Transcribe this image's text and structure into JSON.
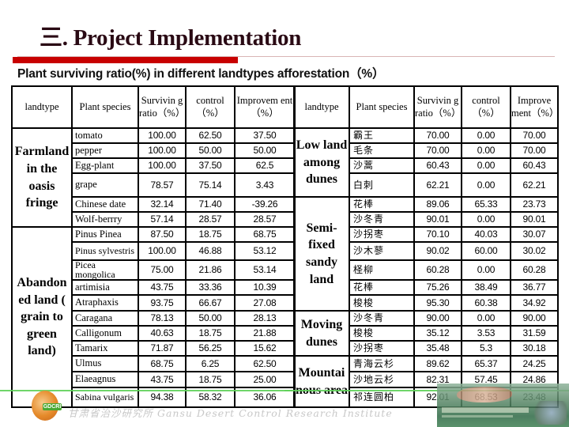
{
  "title": "三. Project Implementation",
  "subtitle": "Plant surviving ratio(%) in different landtypes afforestation（%）",
  "left_table": {
    "headers": [
      "landtype",
      "Plant species",
      "Survivin g ratio（%）",
      "control（%）",
      "Improvem ent（%）"
    ],
    "groups": [
      {
        "landtype": "Farmland in the oasis fringe",
        "rows": [
          {
            "species": "tomato",
            "surviving": "100.00",
            "control": "62.50",
            "improvement": "37.50"
          },
          {
            "species": "pepper",
            "surviving": "100.00",
            "control": "50.00",
            "improvement": "50.00"
          },
          {
            "species": "Egg-plant",
            "surviving": "100.00",
            "control": "37.50",
            "improvement": "62.5"
          },
          {
            "species": "grape",
            "surviving": "78.57",
            "control": "75.14",
            "improvement": "3.43"
          },
          {
            "species": "Chinese date",
            "surviving": "32.14",
            "control": "71.40",
            "improvement": "-39.26"
          },
          {
            "species": "Wolf-berrry",
            "surviving": "57.14",
            "control": "28.57",
            "improvement": "28.57"
          }
        ]
      },
      {
        "landtype": "Abandon ed land ( grain to green land)",
        "rows": [
          {
            "species": "Pinus  Pinea",
            "surviving": "87.50",
            "control": "18.75",
            "improvement": "68.75"
          },
          {
            "species": "Pinus sylvestris",
            "surviving": "100.00",
            "control": "46.88",
            "improvement": "53.12"
          },
          {
            "species": "Picea mongolica",
            "surviving": "75.00",
            "control": "21.86",
            "improvement": "53.14"
          },
          {
            "species": "artimisia",
            "surviving": "43.75",
            "control": "33.36",
            "improvement": "10.39"
          },
          {
            "species": "Atraphaxis",
            "surviving": "93.75",
            "control": "66.67",
            "improvement": "27.08"
          },
          {
            "species": "Caragana",
            "surviving": "78.13",
            "control": "50.00",
            "improvement": "28.13"
          },
          {
            "species": "Calligonum",
            "surviving": "40.63",
            "control": "18.75",
            "improvement": "21.88"
          },
          {
            "species": "Tamarix",
            "surviving": "71.87",
            "control": "56.25",
            "improvement": "15.62"
          },
          {
            "species": "Ulmus",
            "surviving": "68.75",
            "control": "6.25",
            "improvement": "62.50"
          },
          {
            "species": "Elaeagnus",
            "surviving": "43.75",
            "control": "18.75",
            "improvement": "25.00"
          },
          {
            "species": "Sabina vulgaris",
            "surviving": "94.38",
            "control": "58.32",
            "improvement": "36.06"
          }
        ]
      }
    ]
  },
  "right_table": {
    "headers": [
      "landtype",
      "Plant species",
      "Survivin g ratio（%）",
      "control（%）",
      "Improve ment（%）"
    ],
    "groups": [
      {
        "landtype": "Low land among dunes",
        "rows": [
          {
            "species": "霸王",
            "surviving": "70.00",
            "control": "0.00",
            "improvement": "70.00"
          },
          {
            "species": "毛条",
            "surviving": "70.00",
            "control": "0.00",
            "improvement": "70.00"
          },
          {
            "species": "沙蒿",
            "surviving": "60.43",
            "control": "0.00",
            "improvement": "60.43"
          },
          {
            "species": "白刺",
            "surviving": "62.21",
            "control": "0.00",
            "improvement": "62.21"
          }
        ]
      },
      {
        "landtype": "Semi- fixed sandy land",
        "rows": [
          {
            "species": "花棒",
            "surviving": "89.06",
            "control": "65.33",
            "improvement": "23.73"
          },
          {
            "species": "沙冬青",
            "surviving": "90.01",
            "control": "0.00",
            "improvement": "90.01"
          },
          {
            "species": "沙拐枣",
            "surviving": "70.10",
            "control": "40.03",
            "improvement": "30.07"
          },
          {
            "species": "沙木蓼",
            "surviving": "90.02",
            "control": "60.00",
            "improvement": "30.02"
          },
          {
            "species": "柽柳",
            "surviving": "60.28",
            "control": "0.00",
            "improvement": "60.28"
          },
          {
            "species": "花棒",
            "surviving": "75.26",
            "control": "38.49",
            "improvement": "36.77"
          },
          {
            "species": "梭梭",
            "surviving": "95.30",
            "control": "60.38",
            "improvement": "34.92"
          }
        ]
      },
      {
        "landtype": "Moving dunes",
        "rows": [
          {
            "species": "沙冬青",
            "surviving": "90.00",
            "control": "0.00",
            "improvement": "90.00"
          },
          {
            "species": "梭梭",
            "surviving": "35.12",
            "control": "3.53",
            "improvement": "31.59"
          },
          {
            "species": "沙拐枣",
            "surviving": "35.48",
            "control": "5.3",
            "improvement": "30.18"
          }
        ]
      },
      {
        "landtype": "Mountai nous area",
        "rows": [
          {
            "species": "青海云杉",
            "surviving": "89.62",
            "control": "65.37",
            "improvement": "24.25"
          },
          {
            "species": "沙地云杉",
            "surviving": "82.31",
            "control": "57.45",
            "improvement": "24.86"
          },
          {
            "species": "祁连圆柏",
            "surviving": "92.01",
            "control": "68.53",
            "improvement": "23.48"
          }
        ]
      }
    ]
  },
  "footer": {
    "logo_text": "GDCRI",
    "institute": "甘肃省治沙研究所 Gansu Desert Control Research Institute"
  },
  "colors": {
    "accent_red": "#c80000",
    "title": "#2a0a14",
    "footer_green": "#5fd25a"
  }
}
